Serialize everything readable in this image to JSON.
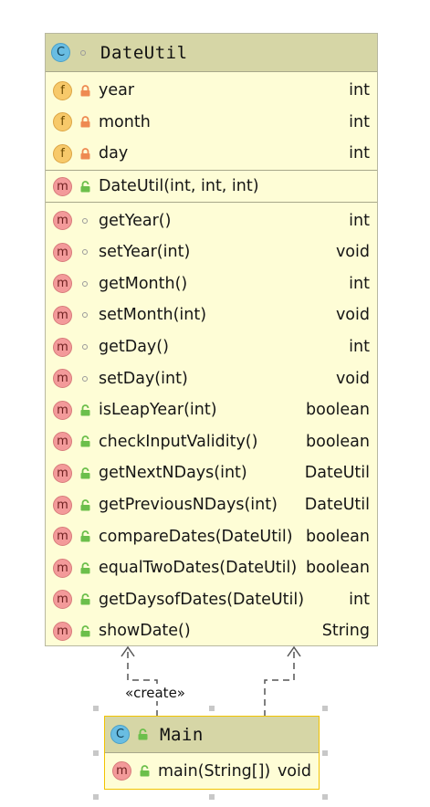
{
  "classes": {
    "dateutil": {
      "kind_icon": "C",
      "name": "DateUtil",
      "fields": [
        {
          "badge": "f",
          "name": "year",
          "type": "int"
        },
        {
          "badge": "f",
          "name": "month",
          "type": "int"
        },
        {
          "badge": "f",
          "name": "day",
          "type": "int"
        }
      ],
      "constructors": [
        {
          "badge": "m",
          "name": "DateUtil(int, int, int)",
          "type": ""
        }
      ],
      "methods": [
        {
          "badge": "m",
          "name": "getYear()",
          "type": "int"
        },
        {
          "badge": "m",
          "name": "setYear(int)",
          "type": "void"
        },
        {
          "badge": "m",
          "name": "getMonth()",
          "type": "int"
        },
        {
          "badge": "m",
          "name": "setMonth(int)",
          "type": "void"
        },
        {
          "badge": "m",
          "name": "getDay()",
          "type": "int"
        },
        {
          "badge": "m",
          "name": "setDay(int)",
          "type": "void"
        },
        {
          "badge": "m",
          "name": "isLeapYear(int)",
          "type": "boolean"
        },
        {
          "badge": "m",
          "name": "checkInputValidity()",
          "type": "boolean"
        },
        {
          "badge": "m",
          "name": "getNextNDays(int)",
          "type": "DateUtil"
        },
        {
          "badge": "m",
          "name": "getPreviousNDays(int)",
          "type": "DateUtil"
        },
        {
          "badge": "m",
          "name": "compareDates(DateUtil)",
          "type": "boolean"
        },
        {
          "badge": "m",
          "name": "equalTwoDates(DateUtil)",
          "type": "boolean"
        },
        {
          "badge": "m",
          "name": "getDaysofDates(DateUtil)",
          "type": "int"
        },
        {
          "badge": "m",
          "name": "showDate()",
          "type": "String"
        }
      ]
    },
    "main": {
      "kind_icon": "C",
      "name": "Main",
      "methods": [
        {
          "badge": "m",
          "name": "main(String[])",
          "type": "void"
        }
      ]
    }
  },
  "relations": {
    "create_label": "«create»"
  },
  "colors": {
    "class_fill": "#fefdd6",
    "header_fill": "#d6d6a6",
    "selection_border": "#f2c300",
    "field_badge": "#f7c96a",
    "method_badge": "#f39a9a",
    "class_badge": "#69bde2",
    "private_lock": "#ee8a52",
    "public_lock": "#6cbf4b"
  }
}
